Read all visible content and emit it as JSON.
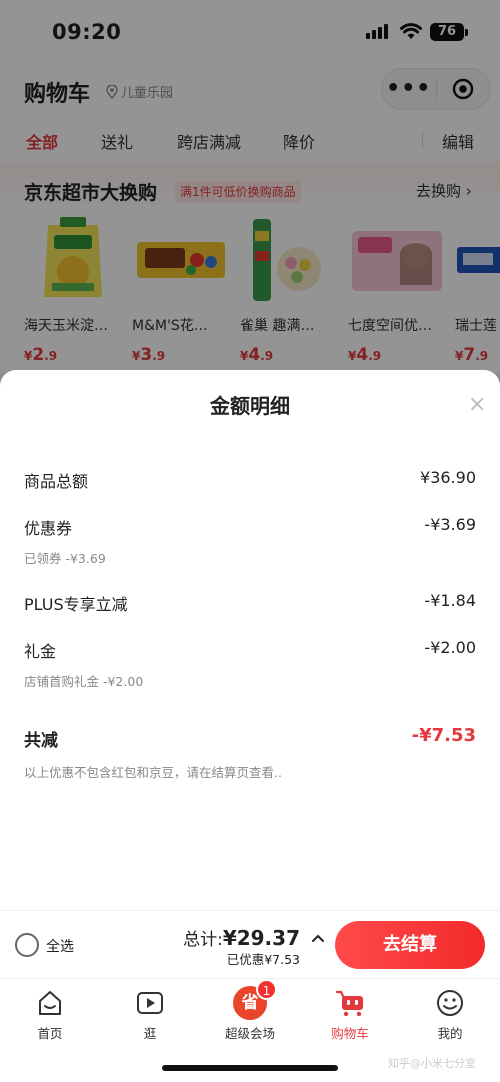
{
  "status_bar": {
    "time": "09:20",
    "battery": "76"
  },
  "header": {
    "title": "购物车",
    "location": "儿童乐园",
    "more_icon": "ellipsis-icon",
    "target_icon": "target-icon"
  },
  "tabs": {
    "items": [
      "全部",
      "送礼",
      "跨店满减",
      "降价"
    ],
    "active": "全部",
    "edit": "编辑"
  },
  "promo": {
    "title": "京东超市大换购",
    "tag": "满1件可低价换购商品",
    "more": "去换购 ›",
    "products": [
      {
        "name": "海天玉米淀…",
        "price_int": "2",
        "price_dec": ".9"
      },
      {
        "name": "M&M'S花…",
        "price_int": "3",
        "price_dec": ".9"
      },
      {
        "name": "雀巢 趣满…",
        "price_int": "4",
        "price_dec": ".9"
      },
      {
        "name": "七度空间优…",
        "price_int": "4",
        "price_dec": ".9"
      },
      {
        "name": "瑞士莲",
        "price_int": "7",
        "price_dec": ".9"
      }
    ],
    "currency": "¥"
  },
  "sheet": {
    "title": "金额明细",
    "close": "×",
    "rows": [
      {
        "label": "商品总额",
        "value": "¥36.90"
      },
      {
        "label": "优惠券",
        "value": "-¥3.69",
        "sub": "已领券 -¥3.69"
      },
      {
        "label": "PLUS专享立减",
        "value": "-¥1.84"
      },
      {
        "label": "礼金",
        "value": "-¥2.00",
        "sub": "店铺首购礼金 -¥2.00"
      }
    ],
    "total_label": "共减",
    "total_value": "-¥7.53",
    "note": "以上优惠不包含红包和京豆，请在结算页查看.."
  },
  "checkout": {
    "select_all": "全选",
    "sum_label": "总计:",
    "sum_value": "¥29.37",
    "saved": "已优惠¥7.53",
    "pay": "去结算"
  },
  "nav": {
    "items": [
      {
        "label": "首页",
        "icon": "home-icon"
      },
      {
        "label": "逛",
        "icon": "video-icon"
      },
      {
        "label": "超级会场",
        "icon": "save-icon",
        "icon_text": "省",
        "badge": "1"
      },
      {
        "label": "购物车",
        "icon": "cart-icon"
      },
      {
        "label": "我的",
        "icon": "profile-icon"
      }
    ],
    "active": "购物车"
  },
  "watermark": "知乎@小米七分室",
  "colors": {
    "accent": "#e4393c",
    "button": "#f22a2a"
  }
}
